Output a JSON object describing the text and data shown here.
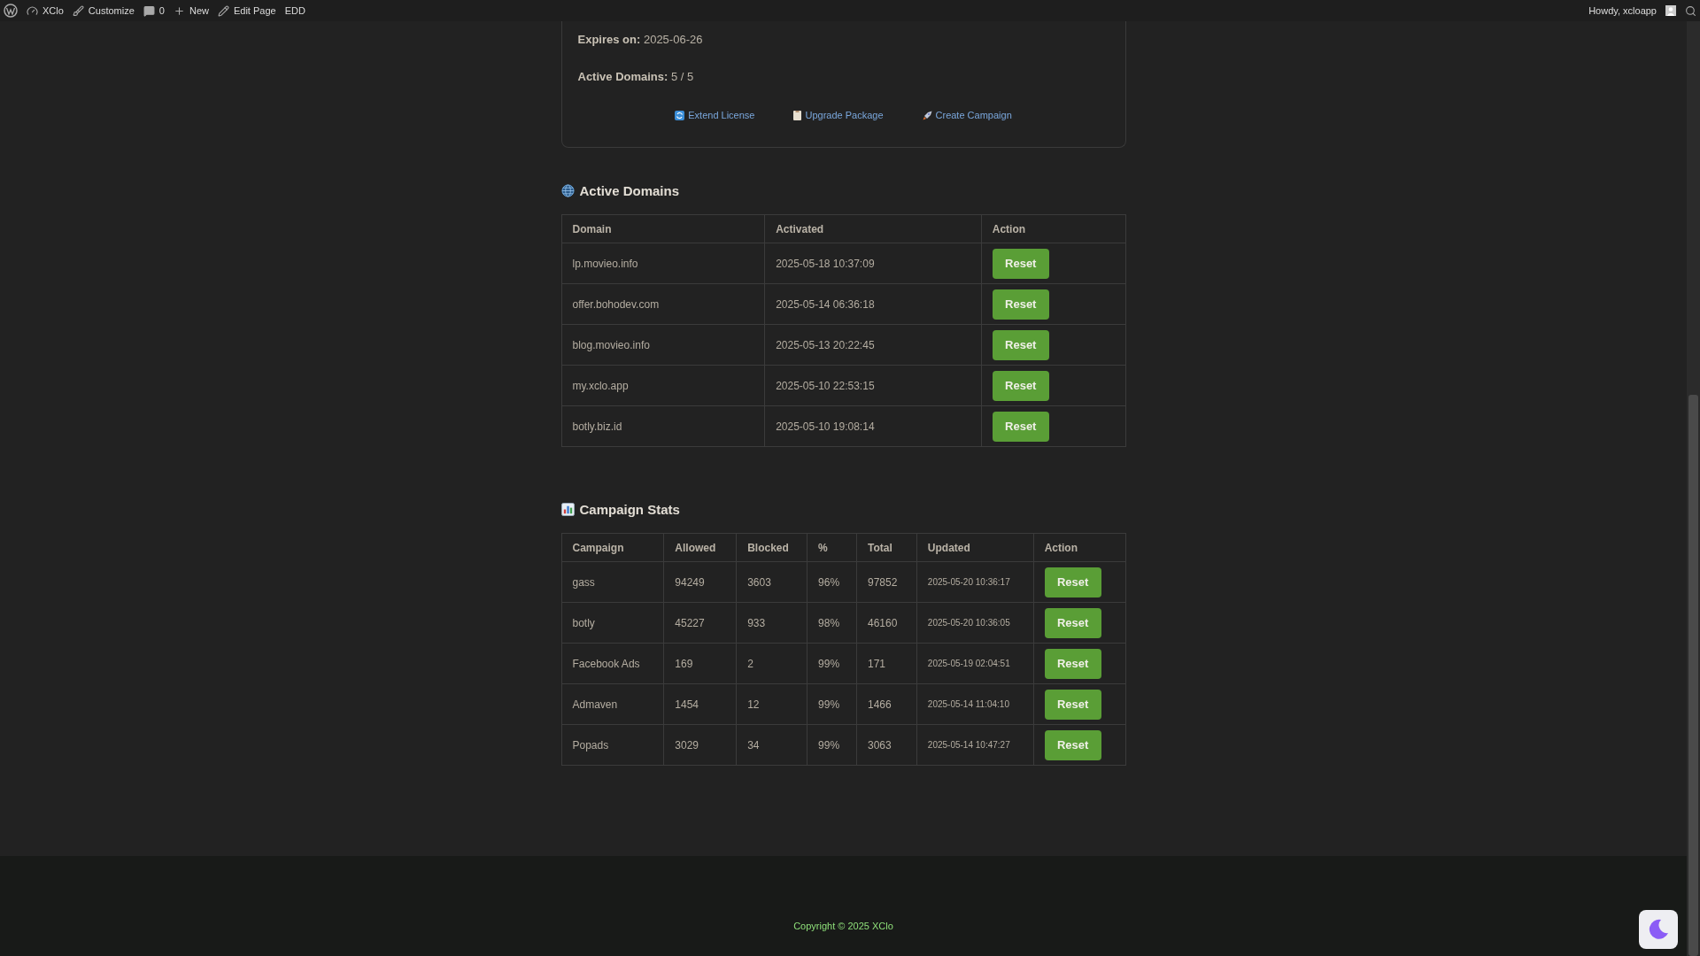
{
  "admin_bar": {
    "items": [
      {
        "kind": "logo"
      },
      {
        "kind": "site",
        "label": "XClo"
      },
      {
        "kind": "customize",
        "label": "Customize"
      },
      {
        "kind": "comments",
        "label": "0"
      },
      {
        "kind": "new",
        "label": "New"
      },
      {
        "kind": "edit",
        "label": "Edit Page"
      },
      {
        "kind": "plain",
        "label": "EDD"
      }
    ],
    "greeting": "Howdy, xcloapp"
  },
  "license": {
    "details": [
      {
        "label": "Expires on:",
        "value": "2025-06-26"
      },
      {
        "label": "Active Domains:",
        "value": "5 / 5"
      }
    ],
    "actions": [
      {
        "kind": "refresh",
        "label": "Extend License"
      },
      {
        "kind": "clipboard",
        "label": "Upgrade Package"
      },
      {
        "kind": "rocket",
        "label": "Create Campaign"
      }
    ]
  },
  "active_domains": {
    "title": "Active Domains",
    "columns": [
      "Domain",
      "Activated",
      "Action"
    ],
    "rows": [
      {
        "domain": "lp.movieo.info",
        "activated": "2025-05-18 10:37:09",
        "action": "Reset"
      },
      {
        "domain": "offer.bohodev.com",
        "activated": "2025-05-14 06:36:18",
        "action": "Reset"
      },
      {
        "domain": "blog.movieo.info",
        "activated": "2025-05-13 20:22:45",
        "action": "Reset"
      },
      {
        "domain": "my.xclo.app",
        "activated": "2025-05-10 22:53:15",
        "action": "Reset"
      },
      {
        "domain": "botly.biz.id",
        "activated": "2025-05-10 19:08:14",
        "action": "Reset"
      }
    ]
  },
  "campaign_stats": {
    "title": "Campaign Stats",
    "columns": [
      "Campaign",
      "Allowed",
      "Blocked",
      "%",
      "Total",
      "Updated",
      "Action"
    ],
    "rows": [
      {
        "campaign": "gass",
        "allowed": "94249",
        "blocked": "3603",
        "percent": "96%",
        "total": "97852",
        "updated": "2025-05-20 10:36:17",
        "action": "Reset"
      },
      {
        "campaign": "botly",
        "allowed": "45227",
        "blocked": "933",
        "percent": "98%",
        "total": "46160",
        "updated": "2025-05-20 10:36:05",
        "action": "Reset"
      },
      {
        "campaign": "Facebook Ads",
        "allowed": "169",
        "blocked": "2",
        "percent": "99%",
        "total": "171",
        "updated": "2025-05-19 02:04:51",
        "action": "Reset"
      },
      {
        "campaign": "Admaven",
        "allowed": "1454",
        "blocked": "12",
        "percent": "99%",
        "total": "1466",
        "updated": "2025-05-14 11:04:10",
        "action": "Reset"
      },
      {
        "campaign": "Popads",
        "allowed": "3029",
        "blocked": "34",
        "percent": "99%",
        "total": "3063",
        "updated": "2025-05-14 10:47:27",
        "action": "Reset"
      }
    ]
  },
  "footer": {
    "copyright": "Copyright © 2025 XClo"
  }
}
